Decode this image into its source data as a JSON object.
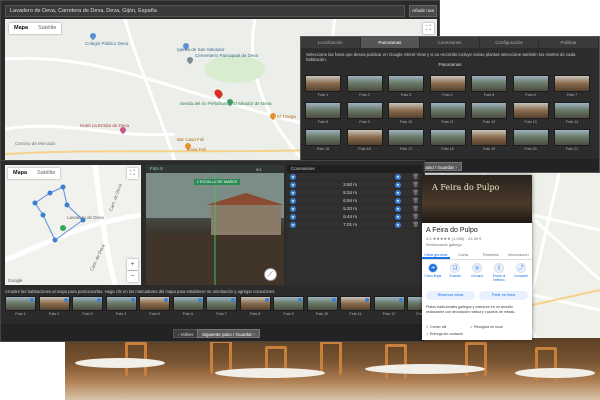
{
  "colors": {
    "accent": "#1a73e8",
    "pin_red": "#d93025",
    "wood": "#c8813c"
  },
  "top_window": {
    "address_value": "Lavadero de Deva, Carretera de Deva, Deva, Gijón, España",
    "address_button": "Añadir ruta",
    "map_type": {
      "map": "Mapa",
      "satellite": "Satélite"
    },
    "pois": [
      "Colegio Público Deva",
      "Iglesia de San Salvador",
      "Cementerio Parroquial de Deva",
      "Senda del río Peñafrancia",
      "El Mirador de Deva",
      "El Trasgu",
      "Hotel La Ermita de Deva",
      "Bar Casa Feli",
      "Casa Feli",
      "Camino de Mercado"
    ]
  },
  "pano_window": {
    "tabs": [
      "Localización",
      "Panoramas",
      "Conexiones",
      "Configuración",
      "Publicar"
    ],
    "instructions": "Seleccione las fotos que desea publicar en Google Street View y si su recorrido incluye varias plantas seleccione también los niveles de cada habitación.",
    "grid_title": "Panoramas",
    "rows": [
      [
        "Foto 1",
        "Foto 2",
        "Foto 3",
        "Foto 4",
        "Foto 5",
        "Foto 6",
        "Foto 7"
      ],
      [
        "Foto 8",
        "Foto 9",
        "Foto 10",
        "Foto 11",
        "Foto 12",
        "Foto 13",
        "Foto 14"
      ],
      [
        "Foto 15",
        "Foto 16",
        "Foto 17",
        "Foto 18",
        "Foto 19",
        "Foto 20",
        "Foto 21"
      ]
    ],
    "back_button": "‹ Volver",
    "next_button": "Siguiente paso / Guardar ›"
  },
  "main_window": {
    "mini_map": {
      "map_type": {
        "map": "Mapa",
        "satellite": "Satélite"
      },
      "street_labels": [
        "Cam. de Deva",
        "Cam. de Deva",
        "Lavadero de Deva"
      ],
      "footer": "Google"
    },
    "street_view": {
      "header": "Foto 8",
      "overlay_label": "L'ESTALLU DE MARES",
      "counter": "9/1"
    },
    "list": {
      "header": "Conexiones",
      "rows": [
        {
          "distance": ""
        },
        {
          "distance": "3.50 m"
        },
        {
          "distance": "8.34 m"
        },
        {
          "distance": "6.94 m"
        },
        {
          "distance": "5.20 m"
        },
        {
          "distance": "6.44 m"
        },
        {
          "distance": "7.01 m"
        }
      ]
    },
    "help_text": "Arrastre las habitaciones al mapa para posicionarlas. Haga clic en los marcadores del mapa para establecer su orientación y agregar conexiones.",
    "strip": [
      "Foto 1",
      "Foto 2",
      "Foto 3",
      "Foto 4",
      "Foto 5",
      "Foto 6",
      "Foto 7",
      "Foto 8",
      "Foto 9",
      "Foto 10",
      "Foto 11",
      "Foto 12",
      "Foto 13"
    ],
    "back_button": "‹ Volver",
    "next_button": "Siguiente paso / Guardar ›"
  },
  "place_card": {
    "sign": "A Feira do Pulpo",
    "title": "A Feira do Pulpo",
    "rating": "4,4 ★★★★★ (1.056) · 20-30 €",
    "category": "Restaurante gallego",
    "tabs": [
      "Vista general",
      "Carta",
      "Reseñas",
      "Información"
    ],
    "actions": [
      "Cómo llegar",
      "Guardar",
      "Cercano",
      "Enviar al teléfono",
      "Compartir"
    ],
    "reserve_button": "Reservar mesa",
    "order_button": "Pedir en línea",
    "description": "Platos tradicionales gallegos y mariscos en un sencillo restaurante con decoración rústica y cuadros de mesas.",
    "features": [
      "Comer allí",
      "Recogida en local",
      "Entrega sin contacto"
    ]
  }
}
